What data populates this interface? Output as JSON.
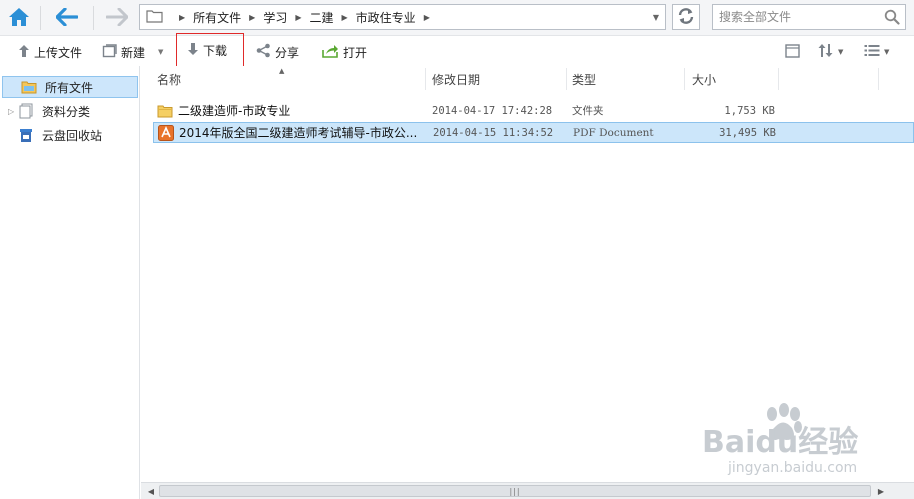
{
  "nav": {
    "breadcrumb": [
      "所有文件",
      "学习",
      "二建",
      "市政住专业"
    ]
  },
  "search": {
    "placeholder": "搜索全部文件"
  },
  "toolbar": {
    "upload_label": "上传文件",
    "new_label": "新建",
    "download_label": "下载",
    "share_label": "分享",
    "open_label": "打开"
  },
  "sidebar": {
    "items": [
      {
        "label": "所有文件"
      },
      {
        "label": "资料分类"
      },
      {
        "label": "云盘回收站"
      }
    ]
  },
  "filelist": {
    "columns": [
      "名称",
      "修改日期",
      "类型",
      "大小"
    ],
    "rows": [
      {
        "name": "二级建造师-市政专业",
        "date": "2014-04-17 17:42:28",
        "type": "文件夹",
        "size": "1,753 KB"
      },
      {
        "name": "2014年版全国二级建造师考试辅导-市政公...",
        "date": "2014-04-15 11:34:52",
        "type": "PDF Document",
        "size": "31,495 KB"
      }
    ]
  },
  "watermark": {
    "brand": "Baidu经验",
    "url": "jingyan.baidu.com"
  },
  "colors": {
    "accent": "#2b8fd6",
    "selection": "#cce6fa",
    "highlight_border": "#e02a2a"
  }
}
